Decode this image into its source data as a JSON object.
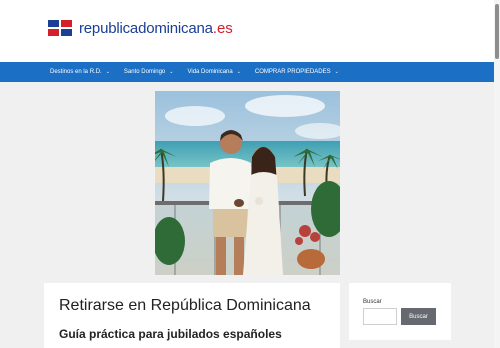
{
  "site": {
    "name": "republicadominicana",
    "tld": ".es"
  },
  "nav": {
    "items": [
      {
        "label": "Destinos en la R.D."
      },
      {
        "label": "Santo Domingo"
      },
      {
        "label": "Vida Dominicana"
      },
      {
        "label": "COMPRAR PROPIEDADES"
      }
    ]
  },
  "hero": {
    "icon": "couple-on-balcony-photo"
  },
  "article": {
    "title": "Retirarse en República Dominicana",
    "subtitle": "Guía práctica para jubilados españoles"
  },
  "sidebar": {
    "search_label": "Buscar",
    "search_placeholder": "",
    "search_button": "Buscar"
  },
  "colors": {
    "brand_blue": "#1b3f95",
    "brand_red": "#d4202a",
    "nav_bg": "#1b6fc4",
    "button_bg": "#666a70"
  }
}
